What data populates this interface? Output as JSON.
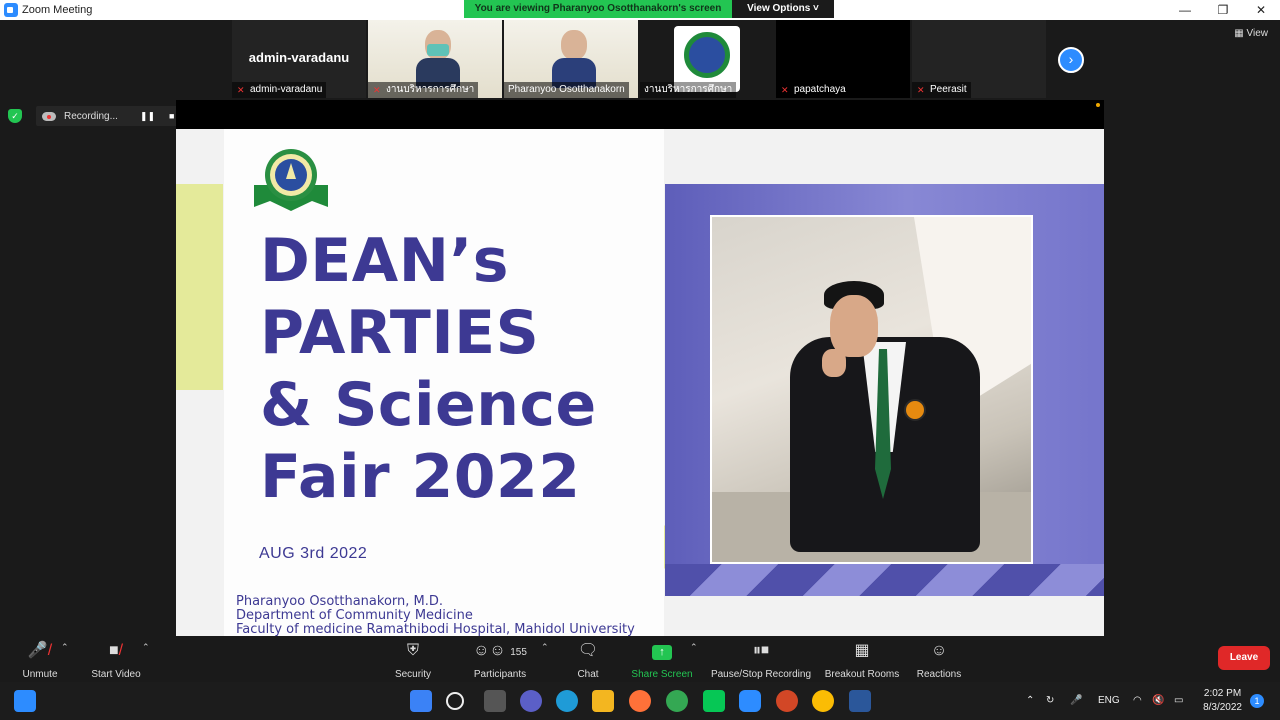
{
  "window": {
    "title": "Zoom Meeting",
    "controls": [
      "—",
      "❐",
      "✕"
    ]
  },
  "banner": {
    "message": "You are viewing Pharanyoo Osotthanakorn's screen",
    "view_options": "View Options ˅"
  },
  "participants_strip": {
    "tiles": [
      {
        "name": "admin-varadanu",
        "big_name": "admin-varadanu",
        "muted": true
      },
      {
        "name": "งานบริหารการศึกษา",
        "muted": true
      },
      {
        "name": "Pharanyoo Osotthanakorn",
        "muted": false
      },
      {
        "name": "งานบริหารการศึกษา",
        "muted": false
      },
      {
        "name": "papatchaya",
        "muted": true
      },
      {
        "name": "Peerasit",
        "muted": true
      }
    ],
    "view_label": "View"
  },
  "recording": {
    "label": "Recording...",
    "pause": "❚❚",
    "stop": "■"
  },
  "slide": {
    "title_lines": [
      "DEAN’s",
      "PARTIES",
      "& Science",
      "Fair 2022"
    ],
    "date": "AUG 3rd 2022",
    "credits": [
      "Pharanyoo Osotthanakorn, M.D.",
      "Department of Community Medicine",
      "Faculty of medicine Ramathibodi Hospital, Mahidol University"
    ],
    "colors": {
      "title": "#3d3993",
      "accent": "#e4ea9a",
      "panel": "#6d6dc6"
    }
  },
  "toolbar": {
    "unmute": "Unmute",
    "start_video": "Start Video",
    "security": "Security",
    "participants": "Participants",
    "participant_count": "155",
    "chat": "Chat",
    "share_screen": "Share Screen",
    "pause_stop_recording": "Pause/Stop Recording",
    "breakout_rooms": "Breakout Rooms",
    "reactions": "Reactions",
    "leave": "Leave"
  },
  "taskbar": {
    "language": "ENG",
    "time": "2:02 PM",
    "date": "8/3/2022",
    "notifications": "1"
  }
}
